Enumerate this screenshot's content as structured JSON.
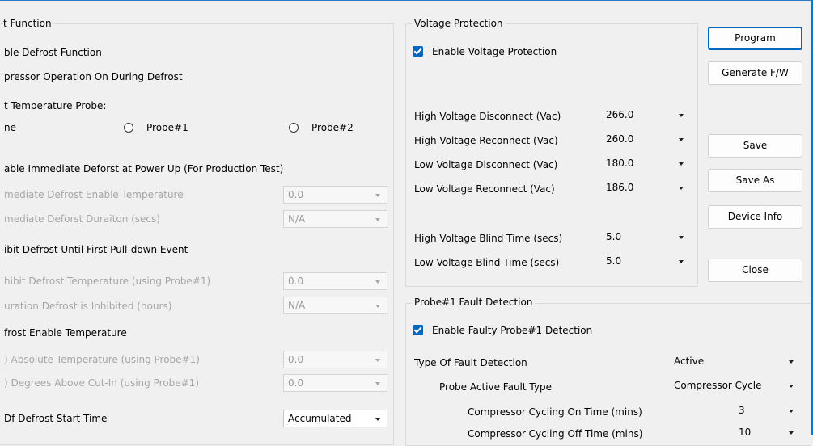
{
  "left": {
    "group_title": "t Function",
    "enable_defrost": "ble Defrost Function",
    "compressor_on": "pressor Operation On During Defrost",
    "temp_probe_label": "t Temperature Probe:",
    "probe_none": "ne",
    "probe1": "Probe#1",
    "probe2": "Probe#2",
    "enable_immediate": "able Immediate Deforst at Power Up (For Production Test)",
    "imm_temp_label": "mediate Defrost Enable Temperature",
    "imm_temp_value": "0.0",
    "imm_dur_label": "mediate Deforst Duraiton (secs)",
    "imm_dur_value": "N/A",
    "inhibit_label": "ibit Defrost Until First Pull-down Event",
    "inhibit_temp_label": "hibit Defrost Temperature (using Probe#1)",
    "inhibit_temp_value": "0.0",
    "inhibit_dur_label": "uration Defrost is Inhibited (hours)",
    "inhibit_dur_value": "N/A",
    "enable_temp_label": "frost Enable Temperature",
    "abs_temp_label": ") Absolute Temperature (using Probe#1)",
    "abs_temp_value": "0.0",
    "deg_above_label": ") Degrees Above Cut-In (using Probe#1)",
    "deg_above_value": "0.0",
    "start_time_label": "Df Defrost Start Time",
    "start_time_value": "Accumulated"
  },
  "voltage": {
    "group_title": "Voltage Protection",
    "enable_label": "Enable Voltage Protection",
    "rows": [
      {
        "label": "High Voltage Disconnect (Vac)",
        "value": "266.0"
      },
      {
        "label": "High Voltage Reconnect (Vac)",
        "value": "260.0"
      },
      {
        "label": "Low Voltage Disconnect (Vac)",
        "value": "180.0"
      },
      {
        "label": "Low Voltage Reconnect (Vac)",
        "value": "186.0"
      },
      {
        "label": "High Voltage Blind Time (secs)",
        "value": "5.0"
      },
      {
        "label": "Low Voltage Blind Time (secs)",
        "value": "5.0"
      }
    ]
  },
  "probe_fault": {
    "group_title": "Probe#1 Fault Detection",
    "enable_label": "Enable Faulty Probe#1 Detection",
    "type_label": "Type Of Fault Detection",
    "type_value": "Active",
    "active_type_label": "Probe Active Fault Type",
    "active_type_value": "Compressor Cycle",
    "on_time_label": "Compressor Cycling On Time (mins)",
    "on_time_value": "3",
    "off_time_label": "Compressor Cycling Off Time (mins)",
    "off_time_value": "10"
  },
  "buttons": {
    "program": "Program",
    "generate": "Generate F/W",
    "save": "Save",
    "save_as": "Save As",
    "device_info": "Device Info",
    "close": "Close"
  },
  "colors": {
    "accent": "#0067c0",
    "window_border": "#2b78c5"
  }
}
